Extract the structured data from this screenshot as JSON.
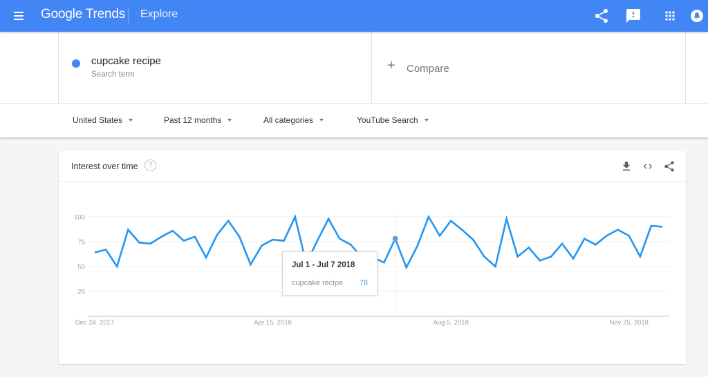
{
  "appbar": {
    "logo_google": "Google",
    "logo_trends": "Trends",
    "section": "Explore",
    "icons": [
      "menu-icon",
      "share-icon",
      "feedback-icon",
      "apps-grid-icon",
      "account-icon"
    ],
    "color": "#4285f4"
  },
  "search": {
    "term": "cupcake recipe",
    "term_type": "Search term",
    "term_color": "#4285f4",
    "compare_label": "Compare",
    "compare_icon": "+"
  },
  "filters": {
    "region": "United States",
    "time_range": "Past 12 months",
    "category": "All categories",
    "search_type": "YouTube Search"
  },
  "card": {
    "title": "Interest over time",
    "help_icon": "?",
    "actions": [
      "download-icon",
      "embed-icon",
      "share-icon"
    ]
  },
  "tooltip": {
    "date": "Jul 1 - Jul 7 2018",
    "term": "cupcake recipe",
    "value": "78"
  },
  "chart_data": {
    "type": "line",
    "title": "Interest over time",
    "xlabel": "",
    "ylabel": "",
    "ylim": [
      0,
      100
    ],
    "y_ticks": [
      25,
      50,
      75,
      100
    ],
    "x_tick_labels": [
      {
        "index": 0,
        "label": "Dec 24, 2017"
      },
      {
        "index": 16,
        "label": "Apr 15, 2018"
      },
      {
        "index": 32,
        "label": "Aug 5, 2018"
      },
      {
        "index": 48,
        "label": "Nov 25, 2018"
      }
    ],
    "grid": true,
    "legend": "none",
    "hover_index": 27,
    "series": [
      {
        "name": "cupcake recipe",
        "color": "#2196f3",
        "values": [
          64,
          67,
          50,
          87,
          74,
          73,
          80,
          86,
          76,
          80,
          59,
          82,
          96,
          80,
          52,
          71,
          77,
          76,
          100,
          53,
          76,
          98,
          78,
          72,
          59,
          59,
          54,
          78,
          49,
          71,
          100,
          81,
          96,
          87,
          77,
          60,
          50,
          98,
          60,
          69,
          56,
          60,
          73,
          58,
          78,
          72,
          81,
          87,
          81,
          60,
          91,
          90
        ]
      }
    ]
  }
}
